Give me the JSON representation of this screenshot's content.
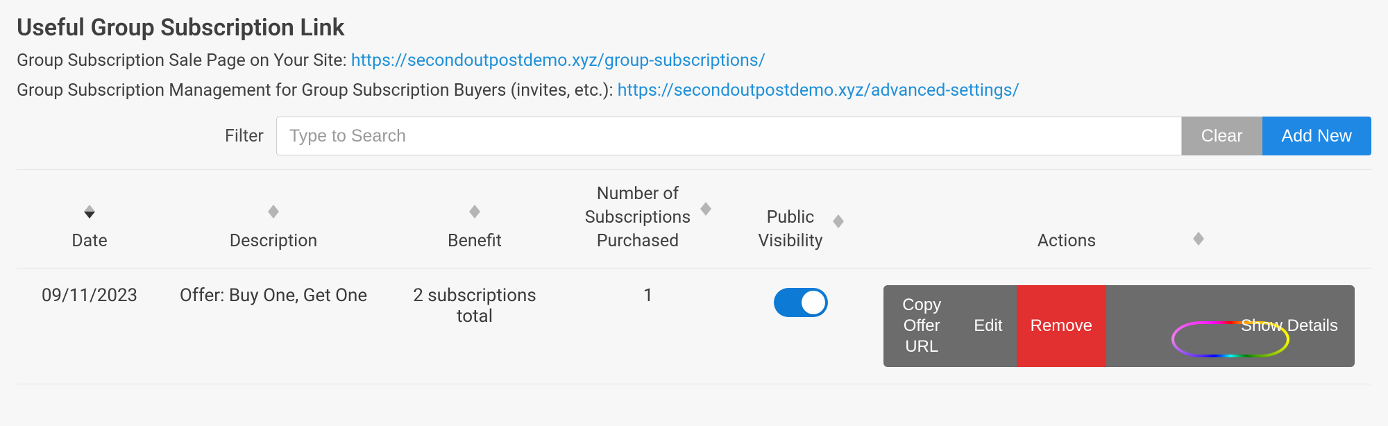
{
  "title": "Useful Group Subscription Link",
  "subline1_prefix": "Group Subscription Sale Page on Your Site: ",
  "subline1_link": "https://secondoutpostdemo.xyz/group-subscriptions/",
  "subline2_prefix": "Group Subscription Management for Group Subscription Buyers (invites, etc.): ",
  "subline2_link": "https://secondoutpostdemo.xyz/advanced-settings/",
  "filter": {
    "label": "Filter",
    "placeholder": "Type to Search",
    "clear": "Clear",
    "add": "Add New"
  },
  "columns": {
    "date": "Date",
    "description": "Description",
    "benefit": "Benefit",
    "num": "Number of\nSubscriptions\nPurchased",
    "visibility": "Public\nVisibility",
    "actions": "Actions"
  },
  "row": {
    "date": "09/11/2023",
    "description": "Offer: Buy One, Get One",
    "benefit": "2 subscriptions total",
    "num": "1",
    "visibility_on": true
  },
  "actions": {
    "copy": "Copy Offer URL",
    "edit": "Edit",
    "remove": "Remove",
    "details": "Show Details"
  }
}
